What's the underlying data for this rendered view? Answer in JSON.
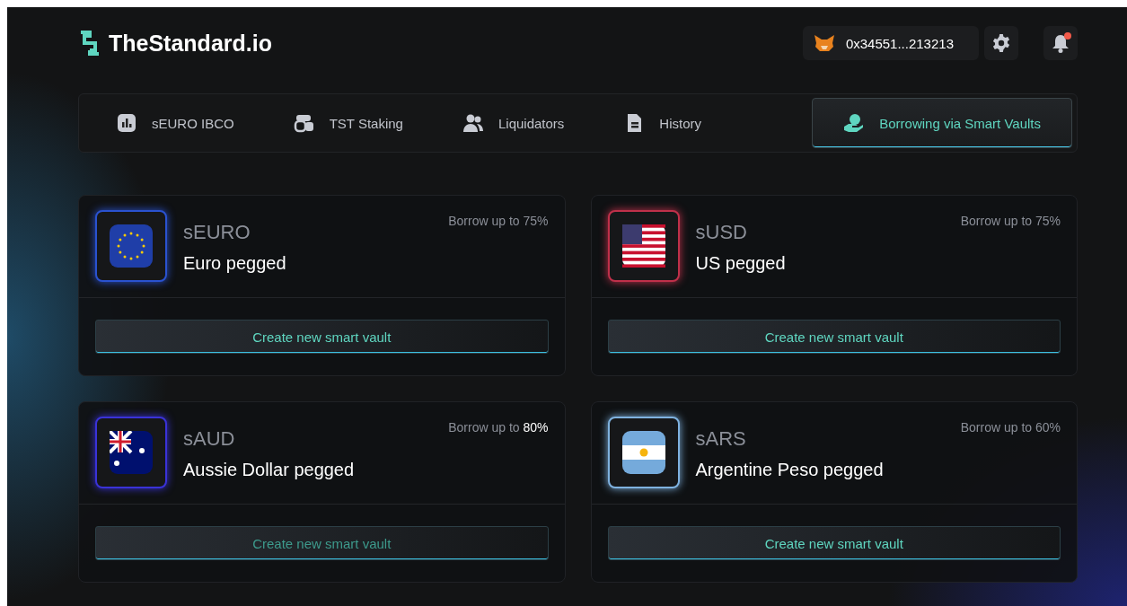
{
  "header": {
    "logo": "TheStandard.io",
    "wallet": "0x34551...213213",
    "notifications": true
  },
  "tabs": [
    {
      "label": "sEURO IBCO",
      "kind": "chart",
      "selected": false
    },
    {
      "label": "TST Staking",
      "kind": "coins",
      "selected": false
    },
    {
      "label": "Liquidators",
      "kind": "users",
      "selected": false
    },
    {
      "label": "History",
      "kind": "document",
      "selected": false
    },
    {
      "label": "Borrowing via Smart Vaults",
      "kind": "hand",
      "selected": true
    }
  ],
  "vaults": [
    {
      "symbol": "sEURO",
      "description": "Euro pegged",
      "borrow": "Borrow up to 75%",
      "kind": "eu",
      "color": "#2a52d0",
      "button": "Create new smart vault",
      "disabled": false
    },
    {
      "symbol": "sUSD",
      "description": "US pegged",
      "borrow": "Borrow up to 75%",
      "kind": "us",
      "color": "#c0304a",
      "button": "Create new smart vault",
      "disabled": false
    },
    {
      "symbol": "sAUD",
      "description": "Aussie Dollar pegged",
      "borrow": "Borrow up to **80%**",
      "kind": "au",
      "color": "#3a32d8",
      "button": "Create new smart vault",
      "disabled": true
    },
    {
      "symbol": "sARS",
      "description": "Argentine Peso pegged",
      "borrow": "Borrow up to 60%",
      "kind": "ar",
      "color": "#7fb2e0",
      "button": "Create new smart vault",
      "disabled": false
    }
  ]
}
